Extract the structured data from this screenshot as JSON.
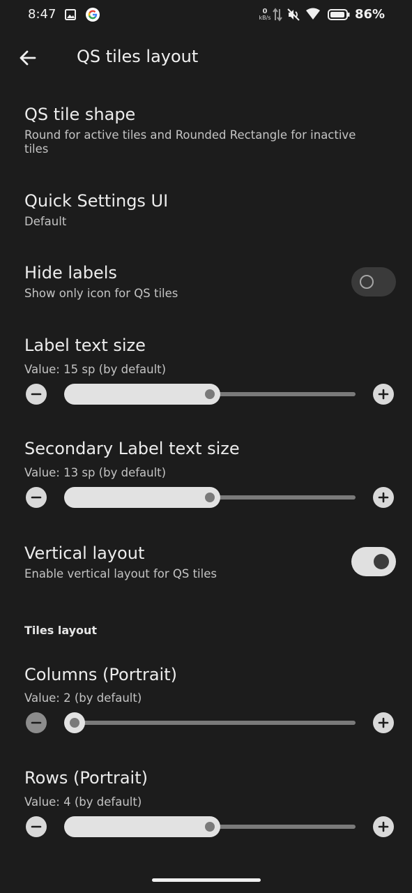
{
  "status_bar": {
    "time": "8:47",
    "net_speed_value": "0",
    "net_speed_unit": "kB/s",
    "battery_percent": "86%",
    "icons": [
      "gallery-icon",
      "google-icon",
      "data-arrows-icon",
      "mute-icon",
      "wifi-icon",
      "battery-icon"
    ]
  },
  "app_bar": {
    "title": "QS tiles layout"
  },
  "preferences": {
    "tile_shape": {
      "title": "QS tile shape",
      "summary_line1": "Round for active tiles and Rounded Rectangle for inactive",
      "summary_line2": "tiles"
    },
    "qs_ui": {
      "title": "Quick Settings UI",
      "summary": "Default"
    },
    "hide_labels": {
      "title": "Hide labels",
      "summary": "Show only icon for QS tiles",
      "enabled": false
    },
    "label_size": {
      "title": "Label text size",
      "summary": "Value: 15 sp (by default)",
      "position_fraction": 0.5
    },
    "secondary_label_size": {
      "title": "Secondary Label text size",
      "summary": "Value: 13 sp (by default)",
      "position_fraction": 0.5
    },
    "vertical_layout": {
      "title": "Vertical layout",
      "summary": "Enable vertical layout for QS tiles",
      "enabled": true
    }
  },
  "tiles_section": {
    "header": "Tiles layout",
    "columns": {
      "title": "Columns (Portrait)",
      "summary": "Value: 2 (by default)",
      "position_fraction": 0.0
    },
    "rows": {
      "title": "Rows (Portrait)",
      "summary": "Value: 4 (by default)",
      "position_fraction": 0.5
    }
  }
}
